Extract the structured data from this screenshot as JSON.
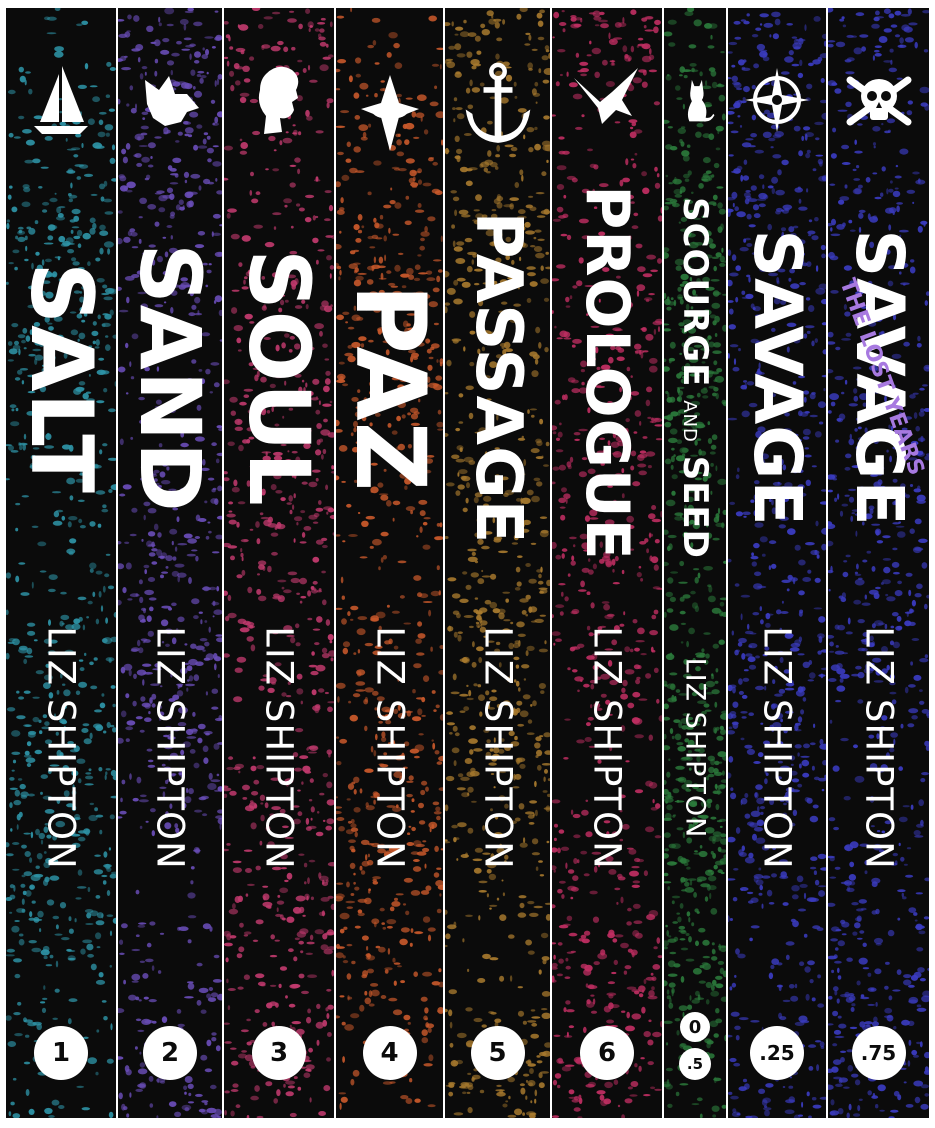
{
  "author": "LIZ SHIPTON",
  "books": [
    {
      "title": "SALT",
      "number": "1",
      "accent": "#2e95a8",
      "icon": "sailboat-icon"
    },
    {
      "title": "SAND",
      "number": "2",
      "accent": "#6a4db8",
      "icon": "fox-head-icon"
    },
    {
      "title": "SOUL",
      "number": "3",
      "accent": "#c23a6e",
      "icon": "woman-profile-icon"
    },
    {
      "title": "PAZ",
      "number": "4",
      "accent": "#c9592b",
      "icon": "spaceship-icon"
    },
    {
      "title": "PASSAGE",
      "number": "5",
      "accent": "#a87a2e",
      "icon": "anchor-icon"
    },
    {
      "title": "PROLOGUE",
      "number": "6",
      "accent": "#c02e62",
      "icon": "swallow-bird-icon"
    },
    {
      "title_part1": "SCOURGE",
      "title_and": "AND",
      "title_part2": "SEED",
      "number_top": "0",
      "number_bottom": ".5",
      "accent": "#2b7a3b",
      "icon": "cat-icon"
    },
    {
      "title": "SAVAGE",
      "number": ".25",
      "accent": "#3b3cc2",
      "icon": "compass-rose-icon"
    },
    {
      "title": "SAVAGE",
      "subtitle": "THE LOST YEARS",
      "number": ".75",
      "accent": "#3b3cc2",
      "subtitle_color": "#a779e0",
      "icon": "skull-crossbones-icon"
    }
  ]
}
